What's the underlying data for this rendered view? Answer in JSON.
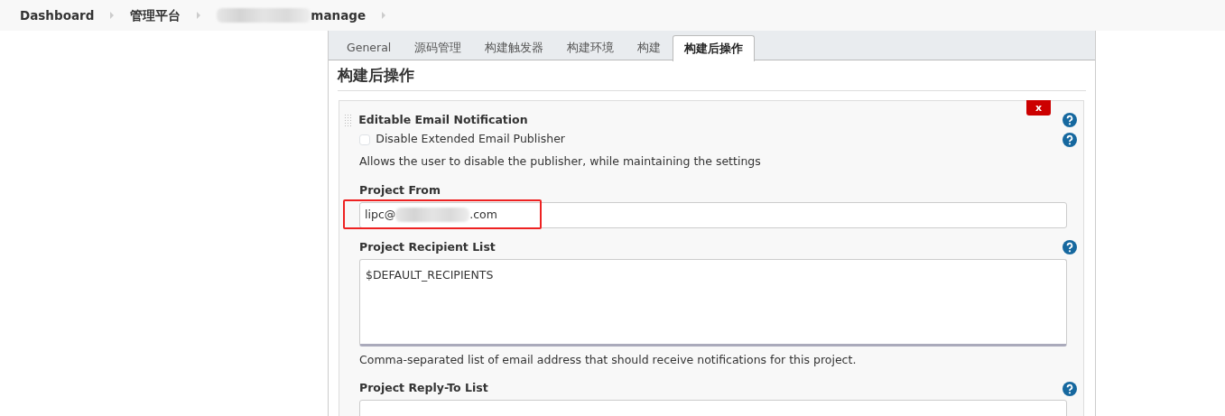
{
  "breadcrumbs": [
    {
      "label": "Dashboard"
    },
    {
      "label": "管理平台"
    },
    {
      "label": "manage",
      "redacted_prefix": true
    }
  ],
  "tabs": [
    {
      "label": "General",
      "selected": false
    },
    {
      "label": "源码管理",
      "selected": false
    },
    {
      "label": "构建触发器",
      "selected": false
    },
    {
      "label": "构建环境",
      "selected": false
    },
    {
      "label": "构建",
      "selected": false
    },
    {
      "label": "构建后操作",
      "selected": true
    }
  ],
  "section": {
    "title": "构建后操作",
    "publisher": {
      "title": "Editable Email Notification",
      "delete_label": "x",
      "disable_option": {
        "label": "Disable Extended Email Publisher",
        "checked": false,
        "description": "Allows the user to disable the publisher, while maintaining the settings"
      },
      "fields": [
        {
          "kind": "text",
          "label": "Project From",
          "value_start": "lipc@",
          "value_end": ".com",
          "highlighted": true,
          "help": false
        },
        {
          "kind": "textarea",
          "label": "Project Recipient List",
          "value": "$DEFAULT_RECIPIENTS",
          "description": "Comma-separated list of email address that should receive notifications for this project.",
          "help": true
        },
        {
          "kind": "text",
          "label": "Project Reply-To List",
          "help": true
        }
      ]
    }
  }
}
